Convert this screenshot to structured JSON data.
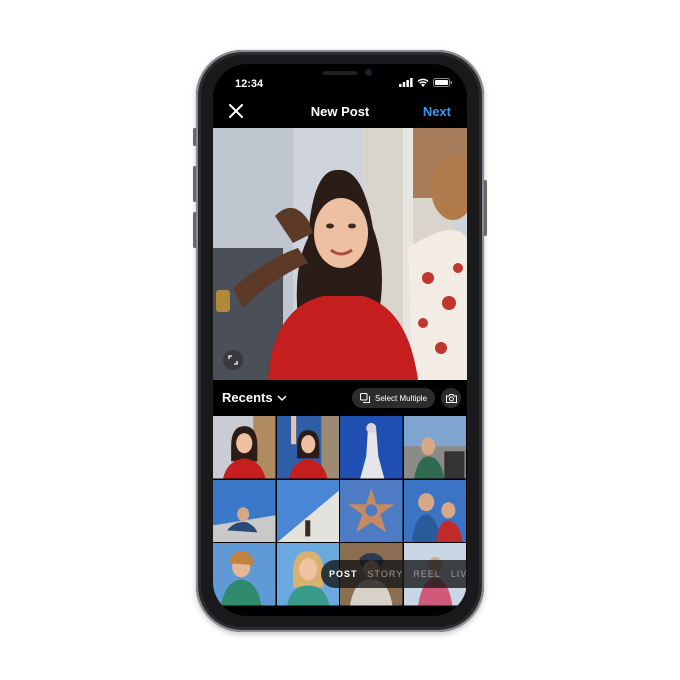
{
  "status_bar": {
    "time": "12:34"
  },
  "header": {
    "title": "New Post",
    "next_label": "Next",
    "close_icon": "close-icon"
  },
  "toolbar": {
    "album_label": "Recents",
    "select_multiple_label": "Select Multiple",
    "camera_icon": "camera-icon"
  },
  "modes": [
    "POST",
    "STORY",
    "REEL",
    "LIVE"
  ],
  "active_mode": "POST",
  "colors": {
    "accent": "#3897f0",
    "background": "#000000",
    "text": "#ffffff"
  }
}
